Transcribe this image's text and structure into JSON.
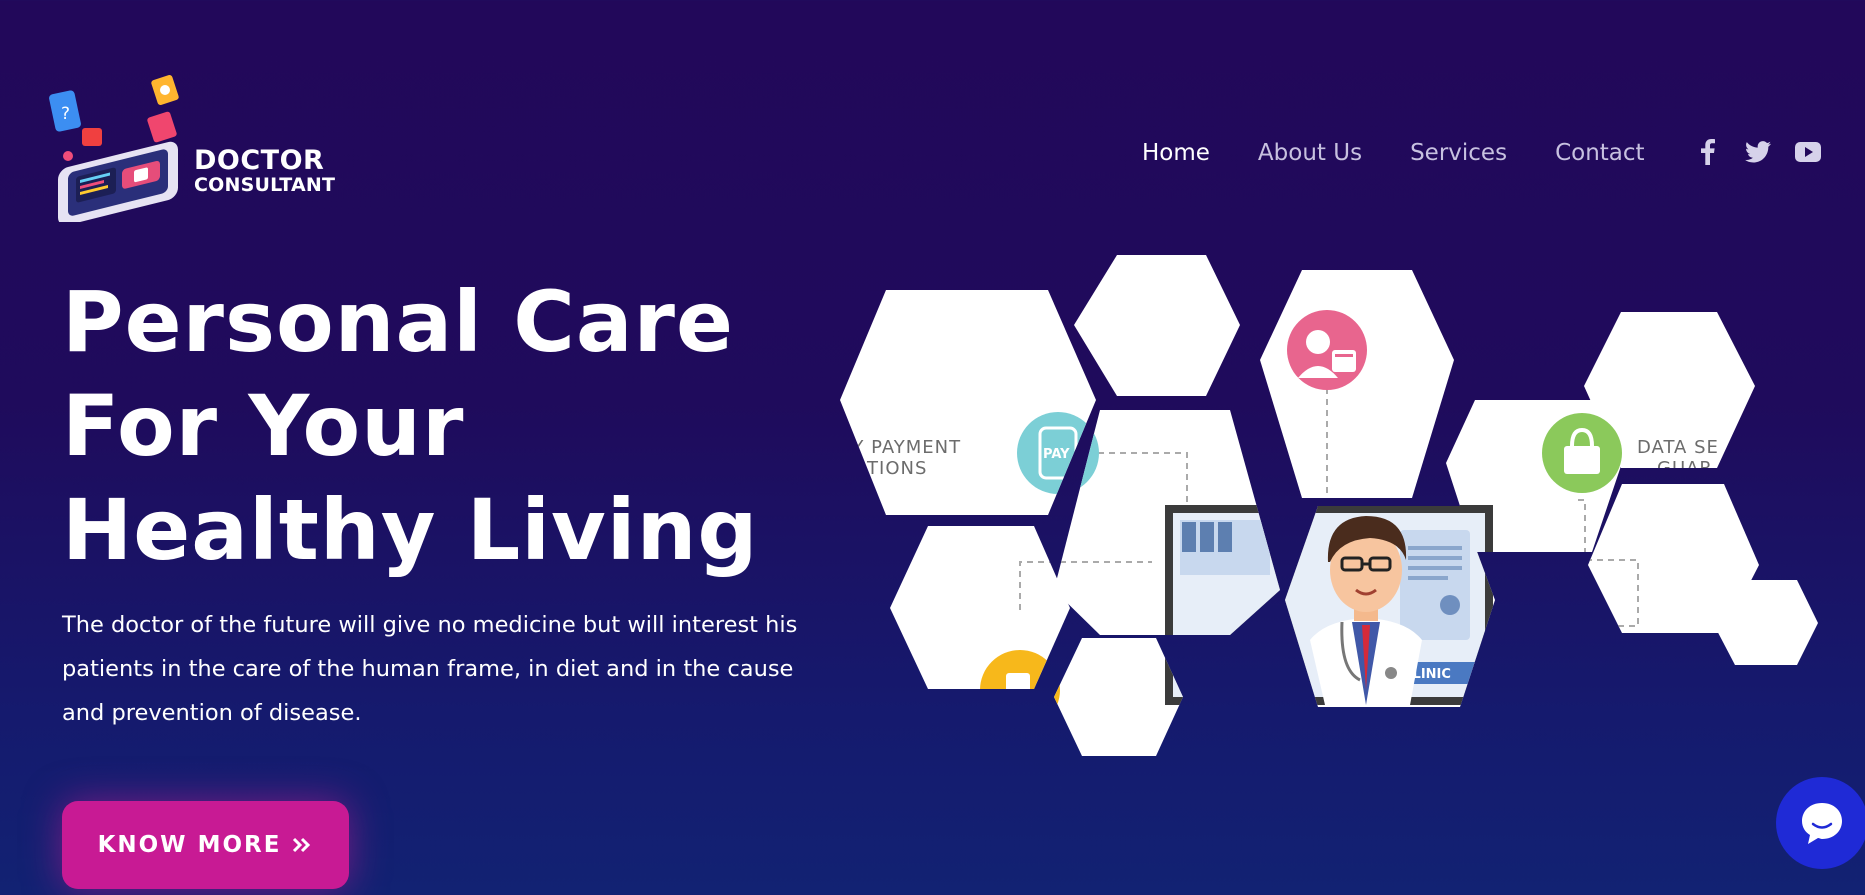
{
  "brand": {
    "line1": "DOCTOR",
    "line2": "CONSULTANT"
  },
  "nav": [
    {
      "label": "Home",
      "active": true
    },
    {
      "label": "About Us",
      "active": false
    },
    {
      "label": "Services",
      "active": false
    },
    {
      "label": "Contact",
      "active": false
    }
  ],
  "social": [
    "facebook-icon",
    "twitter-icon",
    "youtube-icon"
  ],
  "hero": {
    "title_lines": [
      "Personal Care",
      "For Your",
      "Healthy Living"
    ],
    "description": "The doctor of the future will give no medicine but will interest his patients in the care of the human frame, in diet and in the cause and prevention of disease.",
    "cta_label": "KNOW MORE",
    "cta_icon": "double-chevron-right-icon"
  },
  "illustration": {
    "payment_label_line1": "SY PAYMENT",
    "payment_label_line2": "OPTIONS",
    "pay_badge": "PAY",
    "security_label_line1": "DATA SE",
    "security_label_line2": "GUAR",
    "clinic_label": "CLINIC"
  },
  "colors": {
    "background_top": "#22085a",
    "background_bottom": "#122273",
    "cta": "#c81a94",
    "chat": "#1f2ad6"
  }
}
